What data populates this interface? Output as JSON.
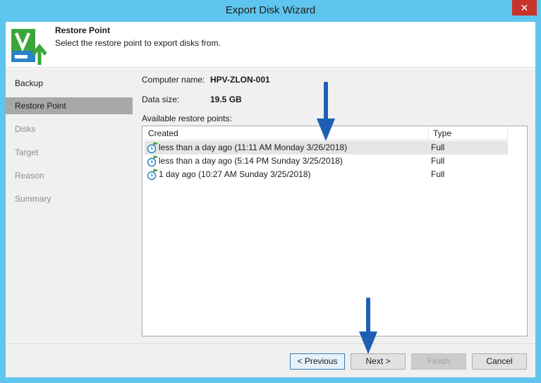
{
  "window": {
    "title": "Export Disk Wizard",
    "close_label": "✕"
  },
  "header": {
    "title": "Restore Point",
    "subtitle": "Select the restore point to export disks from."
  },
  "sidebar": {
    "items": [
      {
        "label": "Backup",
        "state": "done"
      },
      {
        "label": "Restore Point",
        "state": "active"
      },
      {
        "label": "Disks",
        "state": "pending"
      },
      {
        "label": "Target",
        "state": "pending"
      },
      {
        "label": "Reason",
        "state": "pending"
      },
      {
        "label": "Summary",
        "state": "pending"
      }
    ]
  },
  "details": {
    "computer_name_label": "Computer name:",
    "computer_name": "HPV-ZLON-001",
    "data_size_label": "Data size:",
    "data_size": "19.5 GB",
    "available_label": "Available restore points:"
  },
  "table": {
    "columns": [
      "Created",
      "Type"
    ],
    "rows": [
      {
        "created": "less than a day ago (11:11 AM Monday 3/26/2018)",
        "type": "Full",
        "selected": true
      },
      {
        "created": "less than a day ago (5:14 PM Sunday 3/25/2018)",
        "type": "Full",
        "selected": false
      },
      {
        "created": "1 day ago (10:27 AM Sunday 3/25/2018)",
        "type": "Full",
        "selected": false
      }
    ]
  },
  "buttons": {
    "previous": "< Previous",
    "next": "Next >",
    "finish": "Finish",
    "cancel": "Cancel"
  },
  "colors": {
    "title_bar": "#5ec6ee",
    "arrow": "#1e5fb5",
    "logo_green": "#3aa63a",
    "icon_blue": "#2a82c8",
    "flag_green": "#3aa63a"
  },
  "icons": {
    "logo": "veeam-export-logo-icon",
    "restore_point": "restore-point-clock-icon",
    "annotation": "down-arrow-icon"
  }
}
